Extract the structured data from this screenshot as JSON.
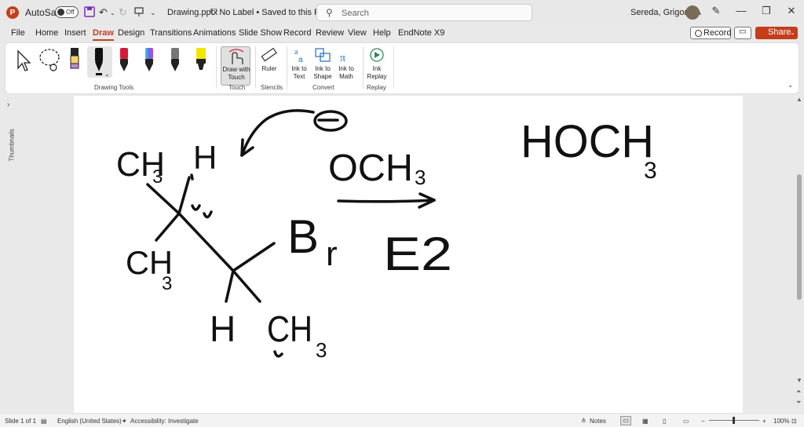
{
  "titlebar": {
    "app_icon": "powerpoint-icon",
    "autosave_label": "AutoSave",
    "autosave_state": "Off",
    "filename": "Drawing.pptx",
    "label_status": "No Label • Saved to this PC",
    "search_placeholder": "Search",
    "user_name": "Sereda, Grigoriy A"
  },
  "tabs": [
    "File",
    "Home",
    "Insert",
    "Draw",
    "Design",
    "Transitions",
    "Animations",
    "Slide Show",
    "Record",
    "Review",
    "View",
    "Help",
    "EndNote X9"
  ],
  "active_tab": "Draw",
  "tab_actions": {
    "record": "Record",
    "share": "Share"
  },
  "ribbon": {
    "groups": {
      "drawing_tools": "Drawing Tools",
      "touch": "Touch",
      "stencils": "Stencils",
      "convert": "Convert",
      "replay": "Replay"
    },
    "buttons": {
      "draw_with_touch": "Draw with Touch",
      "ruler": "Ruler",
      "ink_to_text": "Ink to Text",
      "ink_to_shape": "Ink to Shape",
      "ink_to_math": "Ink to Math",
      "ink_replay": "Ink Replay"
    },
    "pens": [
      {
        "name": "black-pen",
        "color": "#111111"
      },
      {
        "name": "red-pen",
        "color": "#d81b3a"
      },
      {
        "name": "galaxy-pen",
        "color": "#4a56c8"
      },
      {
        "name": "gray-pen",
        "color": "#666666"
      },
      {
        "name": "yellow-highlighter",
        "color": "#f2e600"
      }
    ]
  },
  "thumbnails_label": "Thumbnails",
  "slide_ink": {
    "reagent": "OCH3",
    "mechanism": "E2",
    "product": "HOCH3",
    "leaving_group": "Br",
    "substituents": [
      "CH3",
      "H",
      "CH3",
      "H",
      "CH3"
    ]
  },
  "statusbar": {
    "slide_info": "Slide 1 of 1",
    "language": "English (United States)",
    "accessibility": "Accessibility: Investigate",
    "notes": "Notes",
    "zoom": "100%"
  }
}
